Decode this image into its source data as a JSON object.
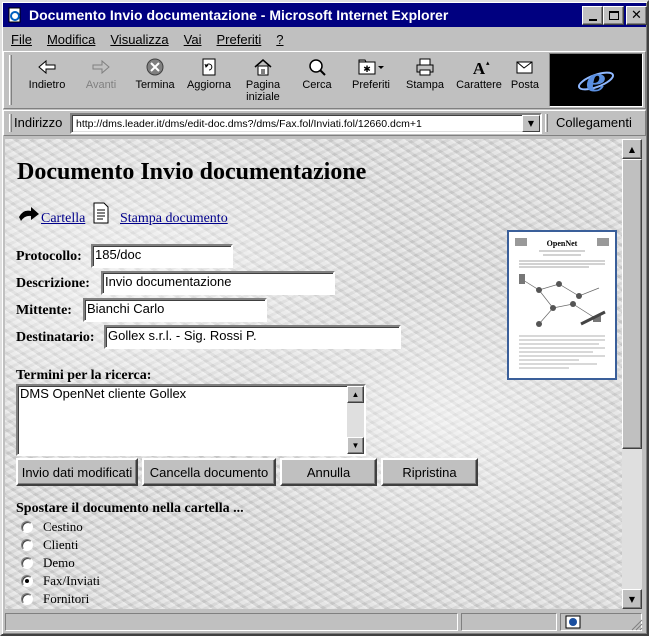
{
  "window": {
    "title": "Documento Invio documentazione  - Microsoft Internet Explorer"
  },
  "menu": [
    "File",
    "Modifica",
    "Visualizza",
    "Vai",
    "Preferiti",
    "?"
  ],
  "toolbar": {
    "back": "Indietro",
    "forward": "Avanti",
    "stop": "Termina",
    "refresh": "Aggiorna",
    "home_line1": "Pagina",
    "home_line2": "iniziale",
    "search": "Cerca",
    "favorites": "Preferiti",
    "print": "Stampa",
    "font": "Carattere",
    "mail": "Posta"
  },
  "address": {
    "label": "Indirizzo",
    "url": "http://dms.leader.it/dms/edit-doc.dms?/dms/Fax.fol/Inviati.fol/12660.dcm+1",
    "links_label": "Collegamenti"
  },
  "page": {
    "heading": "Documento Invio documentazione",
    "folder_link": "Cartella",
    "print_link": "Stampa documento",
    "fields": {
      "protocol_label": "Protocollo:",
      "protocol_value": "185/doc",
      "description_label": "Descrizione:",
      "description_value": "Invio documentazione",
      "sender_label": "Mittente:",
      "sender_value": "Bianchi Carlo",
      "recipient_label": "Destinatario:",
      "recipient_value": "Gollex s.r.l. - Sig. Rossi P."
    },
    "search_terms_label": "Termini per la ricerca:",
    "search_terms_value": "DMS OpenNet cliente Gollex",
    "buttons": {
      "submit": "Invio dati modificati",
      "delete": "Cancella documento",
      "cancel": "Annulla",
      "reset": "Ripristina"
    },
    "move_label": "Spostare il documento nella cartella ...",
    "folders": [
      {
        "label": "Cestino",
        "selected": false
      },
      {
        "label": "Clienti",
        "selected": false
      },
      {
        "label": "Demo",
        "selected": false
      },
      {
        "label": "Fax/Inviati",
        "selected": true
      },
      {
        "label": "Fornitori",
        "selected": false
      }
    ],
    "thumbnail_title": "OpenNet"
  }
}
